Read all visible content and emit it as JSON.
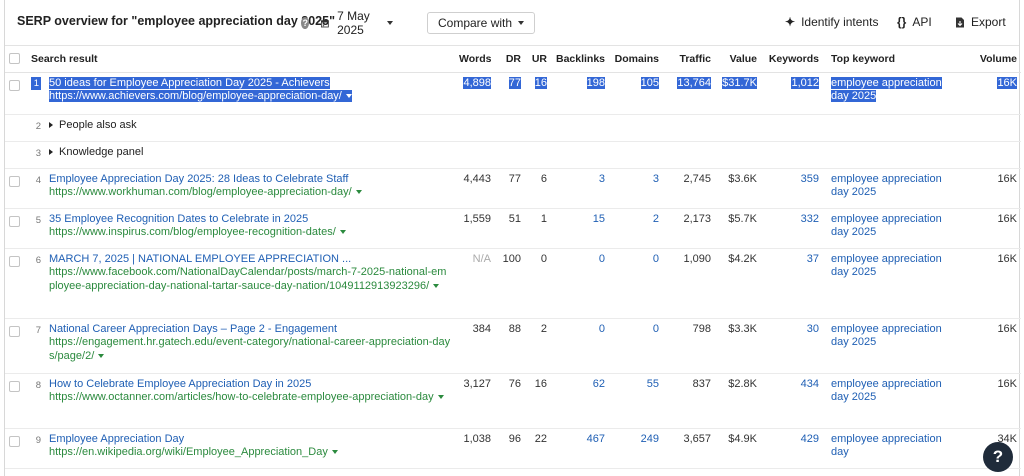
{
  "header": {
    "title": "SERP overview for \"employee appreciation day 2025\"",
    "date": "7 May 2025",
    "compare_label": "Compare with",
    "identify_label": "Identify intents",
    "api_label": "API",
    "export_label": "Export"
  },
  "columns": {
    "search_result": "Search result",
    "words": "Words",
    "dr": "DR",
    "ur": "UR",
    "backlinks": "Backlinks",
    "domains": "Domains",
    "traffic": "Traffic",
    "value": "Value",
    "keywords": "Keywords",
    "top_keyword": "Top keyword",
    "volume": "Volume"
  },
  "rows": [
    {
      "rank": "1",
      "title": "50 ideas for Employee Appreciation Day 2025 - Achievers",
      "url": "https://www.achievers.com/blog/employee-appreciation-day/",
      "words": "4,898",
      "dr": "77",
      "ur": "16",
      "backlinks": "198",
      "domains": "105",
      "traffic": "13,764",
      "value": "$31.7K",
      "keywords": "1,012",
      "top_keyword": "employee appreciation day 2025",
      "volume": "16K"
    },
    {
      "rank": "2",
      "special": "People also ask"
    },
    {
      "rank": "3",
      "special": "Knowledge panel"
    },
    {
      "rank": "4",
      "title": "Employee Appreciation Day 2025: 28 Ideas to Celebrate Staff",
      "url": "https://www.workhuman.com/blog/employee-appreciation-day/",
      "words": "4,443",
      "dr": "77",
      "ur": "6",
      "backlinks": "3",
      "domains": "3",
      "traffic": "2,745",
      "value": "$3.6K",
      "keywords": "359",
      "top_keyword": "employee appreciation day 2025",
      "volume": "16K"
    },
    {
      "rank": "5",
      "title": "35 Employee Recognition Dates to Celebrate in 2025",
      "url": "https://www.inspirus.com/blog/employee-recognition-dates/",
      "words": "1,559",
      "dr": "51",
      "ur": "1",
      "backlinks": "15",
      "domains": "2",
      "traffic": "2,173",
      "value": "$5.7K",
      "keywords": "332",
      "top_keyword": "employee appreciation day 2025",
      "volume": "16K"
    },
    {
      "rank": "6",
      "title": "MARCH 7, 2025 | NATIONAL EMPLOYEE APPRECIATION ...",
      "url": "https://www.facebook.com/NationalDayCalendar/posts/march-7-2025-national-employee-appreciation-day-national-tartar-sauce-day-nation/1049112913923296/",
      "words": "N/A",
      "dr": "100",
      "ur": "0",
      "backlinks": "0",
      "domains": "0",
      "traffic": "1,090",
      "value": "$4.2K",
      "keywords": "37",
      "top_keyword": "employee appreciation day 2025",
      "volume": "16K"
    },
    {
      "rank": "7",
      "title": "National Career Appreciation Days – Page 2 - Engagement",
      "url": "https://engagement.hr.gatech.edu/event-category/national-career-appreciation-days/page/2/",
      "words": "384",
      "dr": "88",
      "ur": "2",
      "backlinks": "0",
      "domains": "0",
      "traffic": "798",
      "value": "$3.3K",
      "keywords": "30",
      "top_keyword": "employee appreciation day 2025",
      "volume": "16K"
    },
    {
      "rank": "8",
      "title": "How to Celebrate Employee Appreciation Day in 2025",
      "url": "https://www.octanner.com/articles/how-to-celebrate-employee-appreciation-day",
      "words": "3,127",
      "dr": "76",
      "ur": "16",
      "backlinks": "62",
      "domains": "55",
      "traffic": "837",
      "value": "$2.8K",
      "keywords": "434",
      "top_keyword": "employee appreciation day 2025",
      "volume": "16K"
    },
    {
      "rank": "9",
      "title": "Employee Appreciation Day",
      "url": "https://en.wikipedia.org/wiki/Employee_Appreciation_Day",
      "words": "1,038",
      "dr": "96",
      "ur": "22",
      "backlinks": "467",
      "domains": "249",
      "traffic": "3,657",
      "value": "$4.9K",
      "keywords": "429",
      "top_keyword": "employee appreciation day",
      "volume": "34K"
    }
  ],
  "help_label": "?",
  "colors": {
    "link": "#1f5fb4",
    "url": "#2b8a3e",
    "selection": "#3367d6"
  }
}
